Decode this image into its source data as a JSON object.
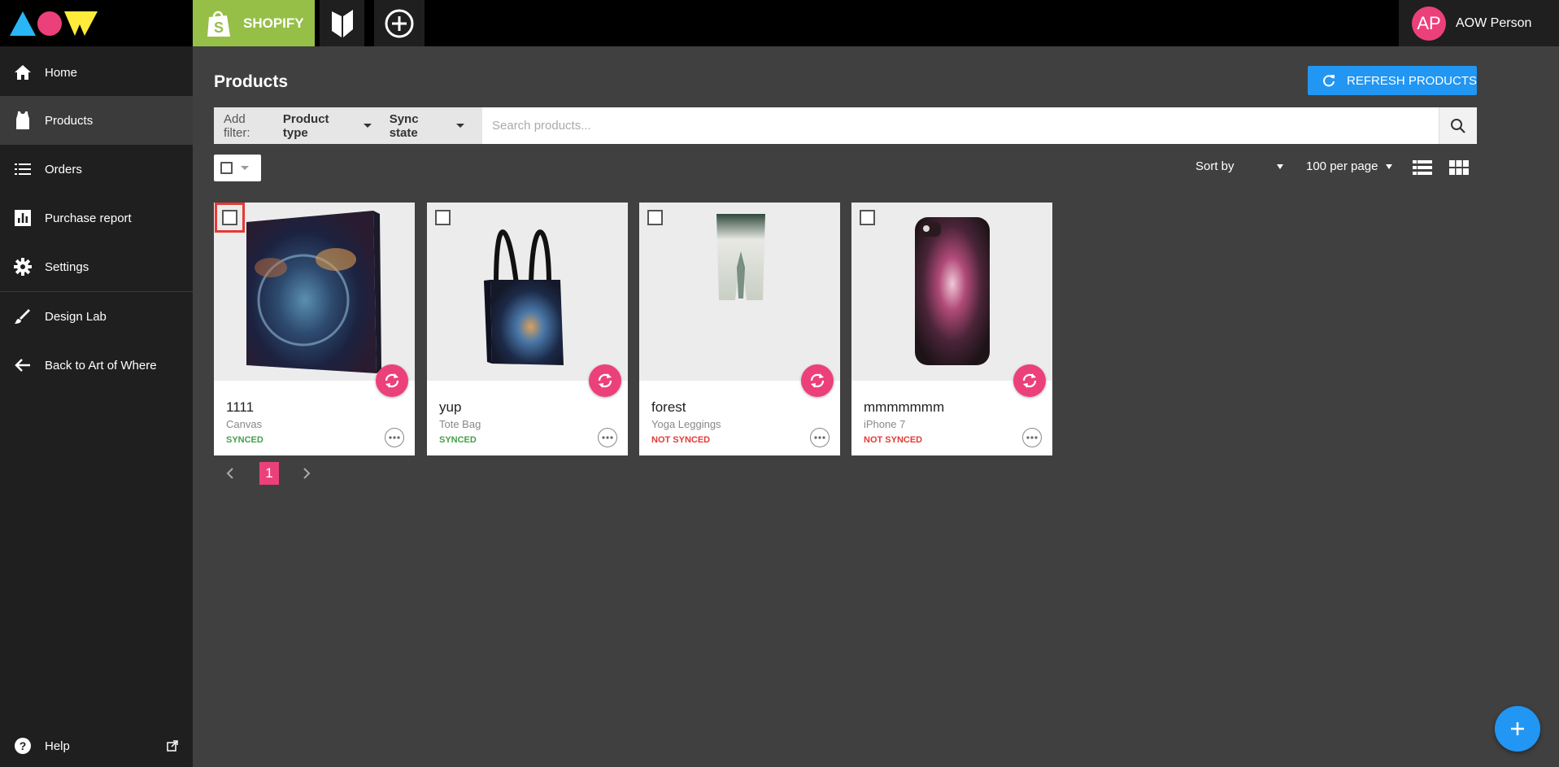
{
  "topbar": {
    "shopify_label": "SHOPIFY",
    "user_initials": "AP",
    "user_name": "AOW Person"
  },
  "sidebar": {
    "items": [
      {
        "label": "Home",
        "icon": "home-icon"
      },
      {
        "label": "Products",
        "icon": "tank-top-icon",
        "active": true
      },
      {
        "label": "Orders",
        "icon": "list-icon"
      },
      {
        "label": "Purchase report",
        "icon": "bar-chart-icon"
      },
      {
        "label": "Settings",
        "icon": "gear-icon"
      },
      {
        "label": "Design Lab",
        "icon": "brush-icon"
      },
      {
        "label": "Back to Art of Where",
        "icon": "arrow-left-icon"
      }
    ],
    "help_label": "Help"
  },
  "main": {
    "title": "Products",
    "refresh_label": "REFRESH PRODUCTS",
    "filter": {
      "add_label": "Add filter:",
      "product_type": "Product type",
      "sync_state": "Sync state"
    },
    "search_placeholder": "Search products...",
    "sort_label": "Sort by",
    "per_page_label": "100 per page"
  },
  "products": [
    {
      "name": "1111",
      "type": "Canvas",
      "status": "SYNCED"
    },
    {
      "name": "yup",
      "type": "Tote Bag",
      "status": "SYNCED"
    },
    {
      "name": "forest",
      "type": "Yoga Leggings",
      "status": "NOT SYNCED"
    },
    {
      "name": "mmmmmmm",
      "type": "iPhone 7",
      "status": "NOT SYNCED"
    }
  ],
  "pagination": {
    "current": "1"
  },
  "colors": {
    "brand_pink": "#ec407a",
    "brand_blue": "#2196f3",
    "shopify_green": "#96bf48",
    "synced_green": "#43a047",
    "not_synced_red": "#e53935"
  }
}
